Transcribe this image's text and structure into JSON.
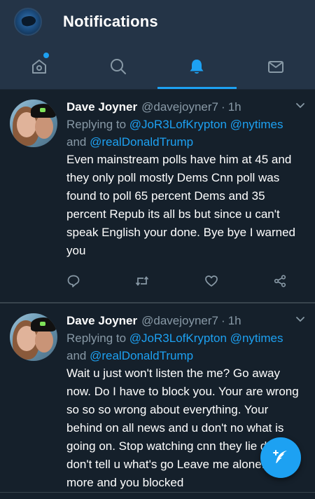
{
  "header": {
    "title": "Notifications"
  },
  "tabs": [
    {
      "icon": "home-icon"
    },
    {
      "icon": "search-icon"
    },
    {
      "icon": "bell-icon"
    },
    {
      "icon": "mail-icon"
    }
  ],
  "tweets": [
    {
      "name": "Dave Joyner",
      "handle": "@davejoyner7",
      "sep": "·",
      "time": "1h",
      "replying_prefix": "Replying to",
      "replying_users": "@JoR3LofKrypton @nytimes",
      "replying_and": "and",
      "replying_last": "@realDonaldTrump",
      "text": "Even mainstream  polls have him at 45 and they only poll mostly Dems Cnn poll was found to poll 65 percent Dems and 35 percent Repub its all bs but since u can't speak English your done. Bye bye I warned you"
    },
    {
      "name": "Dave Joyner",
      "handle": "@davejoyner7",
      "sep": "·",
      "time": "1h",
      "replying_prefix": "Replying to",
      "replying_users": "@JoR3LofKrypton @nytimes",
      "replying_and": "and",
      "replying_last": "@realDonaldTrump",
      "text": "Wait u just won't listen the me? Go away now. Do I have to block you. Your are wrong so so so wrong about everything. Your behind on all news and u don't no what is going on. Stop watching cnn they lie dnd don't tell u what's go Leave me alone. 1 more and you blocked"
    }
  ],
  "colors": {
    "accent": "#1da1f2",
    "background": "#15202b",
    "header": "#243447",
    "muted": "#8899a6"
  }
}
